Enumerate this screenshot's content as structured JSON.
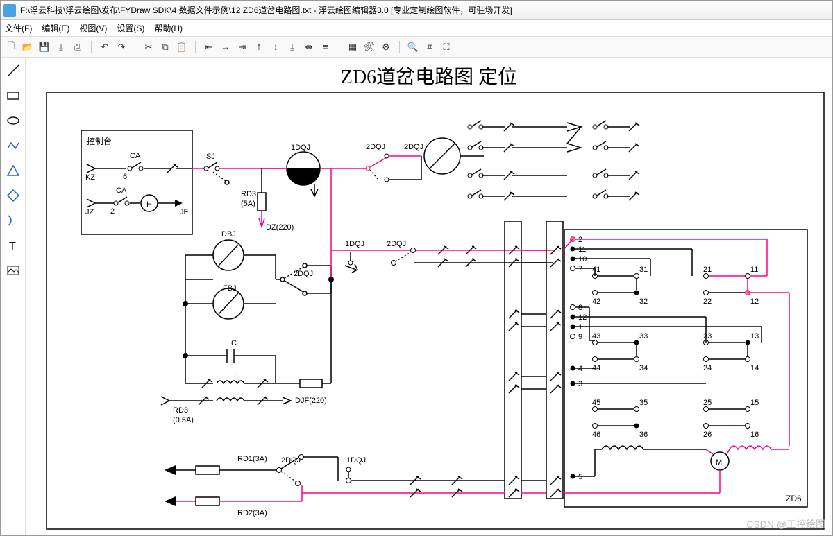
{
  "app": {
    "title": "F:\\浮云科技\\浮云绘图\\发布\\FYDraw SDK\\4 数据文件示例\\12 ZD6道岔电路图.txt - 浮云绘图编辑器3.0 [专业定制绘图软件，可驻场开发]"
  },
  "menus": {
    "file": "文件(F)",
    "edit": "编辑(E)",
    "view": "视图(V)",
    "settings": "设置(S)",
    "help": "帮助(H)"
  },
  "diagram": {
    "title": "ZD6道岔电路图  定位",
    "control_panel": "控制台",
    "labels": {
      "kz": "KZ",
      "jz": "JZ",
      "jf": "JF",
      "ca": "CA",
      "h": "H",
      "sj": "SJ",
      "dq1": "1DQJ",
      "dq2": "2DQJ",
      "rd3a": "RD3",
      "rd3a_val": "(5A)",
      "dz": "DZ(220)",
      "dbj": "DBJ",
      "fbj": "FBJ",
      "c": "C",
      "ii": "II",
      "i": "I",
      "rd3b": "RD3",
      "rd3b_val": "(0.5A)",
      "djf": "DJF(220)",
      "rd1": "RD1(3A)",
      "rd2": "RD2(3A)",
      "zd6": "ZD6",
      "m": "M",
      "n6": "6",
      "n2": "2",
      "t2": "2",
      "t11": "11",
      "t10": "10",
      "t7": "7",
      "t8": "8",
      "t12": "12",
      "t1": "1",
      "t9": "9",
      "t4": "4",
      "t3": "3",
      "t5": "5",
      "p41": "41",
      "p31": "31",
      "p21": "21",
      "p11": "11",
      "p42": "42",
      "p32": "32",
      "p22": "22",
      "p12": "12",
      "p43": "43",
      "p33": "33",
      "p23": "23",
      "p13": "13",
      "p44": "44",
      "p34": "34",
      "p24": "24",
      "p14": "14",
      "p45": "45",
      "p35": "35",
      "p25": "25",
      "p15": "15",
      "p46": "46",
      "p36": "36",
      "p26": "26",
      "p16": "16"
    }
  },
  "watermark": "CSDN @工控绘图"
}
